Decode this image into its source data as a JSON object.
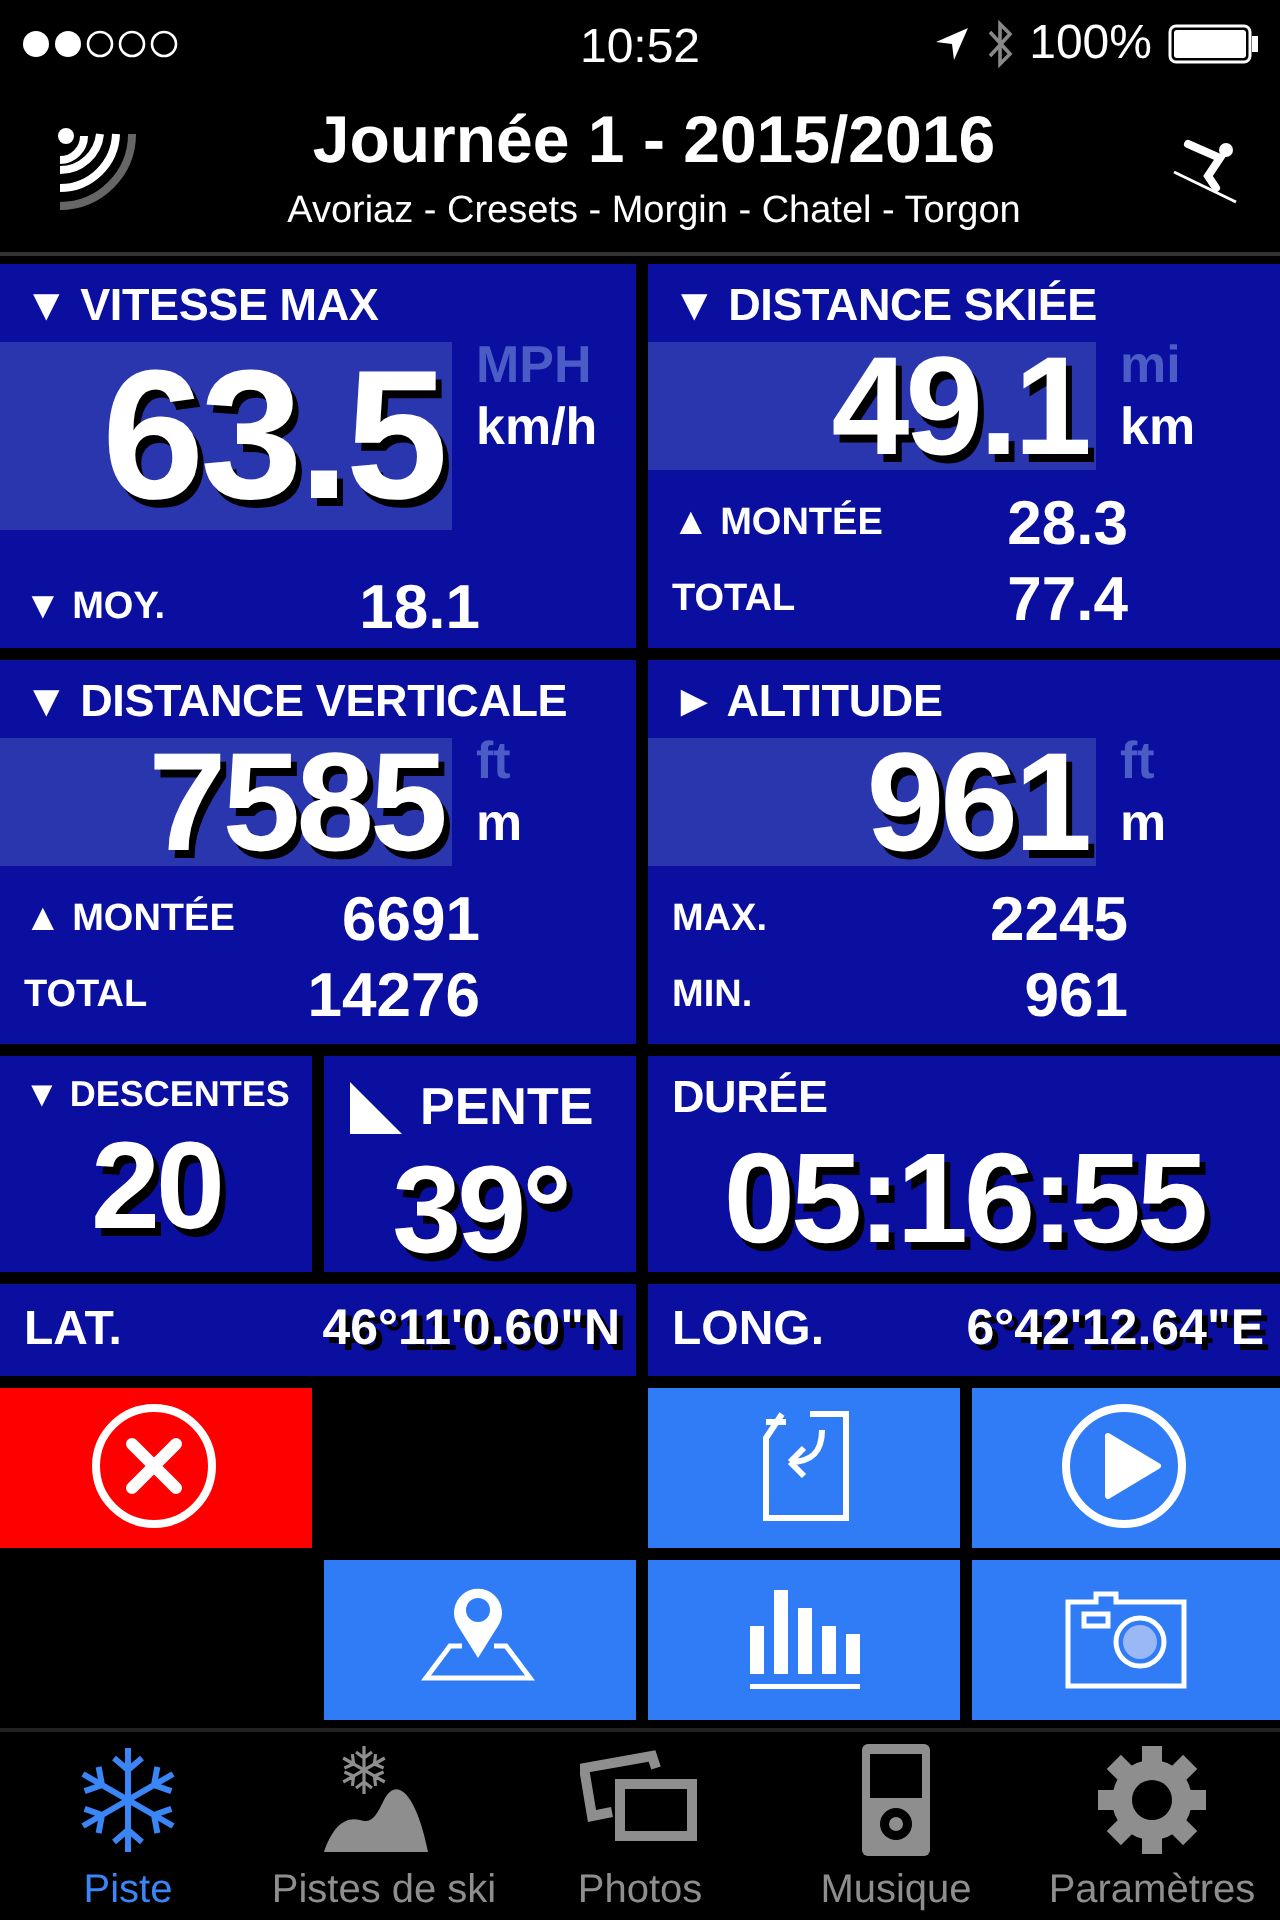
{
  "status_bar": {
    "time": "10:52",
    "battery": "100%"
  },
  "header": {
    "title": "Journée 1 - 2015/2016",
    "subtitle": "Avoriaz - Cresets - Morgin - Chatel - Torgon"
  },
  "panels": [
    {
      "kind": "main",
      "title": "▼ VITESSE MAX",
      "value": "63.5",
      "units": [
        {
          "label": "MPH",
          "selected": false
        },
        {
          "label": "km/h",
          "selected": true
        }
      ],
      "stats": [
        {
          "label": "▼ MOY.",
          "value": "18.1"
        }
      ]
    },
    {
      "kind": "main",
      "title": "▼ DISTANCE SKIÉE",
      "value": "49.1",
      "units": [
        {
          "label": "mi",
          "selected": false
        },
        {
          "label": "km",
          "selected": true
        }
      ],
      "stats": [
        {
          "label": "▲ MONTÉE",
          "value": "28.3"
        },
        {
          "label": "TOTAL",
          "value": "77.4"
        }
      ]
    },
    {
      "kind": "main",
      "title": "▼ DISTANCE VERTICALE",
      "value": "7585",
      "units": [
        {
          "label": "ft",
          "selected": false
        },
        {
          "label": "m",
          "selected": true
        }
      ],
      "stats": [
        {
          "label": "▲ MONTÉE",
          "value": "6691"
        },
        {
          "label": "TOTAL",
          "value": "14276"
        }
      ]
    },
    {
      "kind": "main",
      "title": "► ALTITUDE",
      "value": "961",
      "units": [
        {
          "label": "ft",
          "selected": false
        },
        {
          "label": "m",
          "selected": true
        }
      ],
      "stats": [
        {
          "label": "MAX.",
          "value": "2245"
        },
        {
          "label": "MIN.",
          "value": "961"
        }
      ]
    },
    {
      "kind": "count",
      "title": "▼ DESCENTES",
      "value": "20"
    },
    {
      "kind": "slope",
      "title": "PENTE",
      "value": "39°"
    },
    {
      "kind": "duration",
      "title": "DURÉE",
      "value": "05:16:55"
    },
    {
      "kind": "coord",
      "title": "LAT.",
      "value": "46°11'0.60\"N"
    },
    {
      "kind": "coord",
      "title": "LONG.",
      "value": "6°42'12.64\"E"
    }
  ],
  "action_rows": [
    [
      {
        "kind": "cancel"
      },
      null,
      {
        "kind": "import"
      },
      {
        "kind": "play"
      }
    ],
    [
      null,
      {
        "kind": "map"
      },
      {
        "kind": "chart"
      },
      {
        "kind": "camera"
      }
    ]
  ],
  "tabs": [
    {
      "label": "Piste",
      "selected": true
    },
    {
      "label": "Pistes de ski",
      "selected": false
    },
    {
      "label": "Photos",
      "selected": false
    },
    {
      "label": "Musique",
      "selected": false
    },
    {
      "label": "Paramètres",
      "selected": false
    }
  ]
}
